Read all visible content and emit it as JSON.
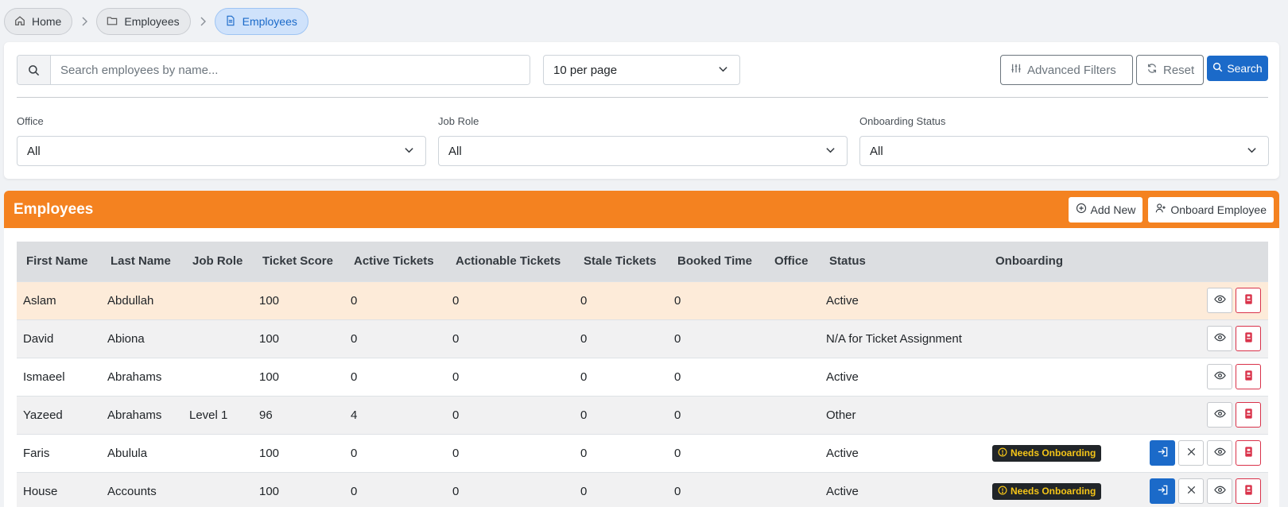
{
  "breadcrumb": [
    {
      "label": "Home",
      "icon": "home-icon"
    },
    {
      "label": "Employees",
      "icon": "folder-icon"
    },
    {
      "label": "Employees",
      "icon": "document-icon"
    }
  ],
  "filters": {
    "search_placeholder": "Search employees by name...",
    "per_page": "10 per page",
    "advanced_label": "Advanced Filters",
    "reset_label": "Reset",
    "search_label": "Search",
    "office_label": "Office",
    "office_value": "All",
    "jobrole_label": "Job Role",
    "jobrole_value": "All",
    "onboarding_label": "Onboarding Status",
    "onboarding_value": "All"
  },
  "employees": {
    "title": "Employees",
    "add_new": "Add New",
    "onboard": "Onboard Employee",
    "columns": [
      "First Name",
      "Last Name",
      "Job Role",
      "Ticket Score",
      "Active Tickets",
      "Actionable Tickets",
      "Stale Tickets",
      "Booked Time",
      "Office",
      "Status",
      "Onboarding"
    ],
    "rows": [
      [
        "Aslam",
        "Abdullah",
        "",
        "100",
        "0",
        "0",
        "0",
        "0",
        "",
        "Active",
        ""
      ],
      [
        "David",
        "Abiona",
        "",
        "100",
        "0",
        "0",
        "0",
        "0",
        "",
        "N/A for Ticket Assignment",
        ""
      ],
      [
        "Ismaeel",
        "Abrahams",
        "",
        "100",
        "0",
        "0",
        "0",
        "0",
        "",
        "Active",
        ""
      ],
      [
        "Yazeed",
        "Abrahams",
        "Level 1",
        "96",
        "4",
        "0",
        "0",
        "0",
        "",
        "Other",
        ""
      ],
      [
        "Faris",
        "Abulula",
        "",
        "100",
        "0",
        "0",
        "0",
        "0",
        "",
        "Active",
        "Needs Onboarding"
      ],
      [
        "House",
        "Accounts",
        "",
        "100",
        "0",
        "0",
        "0",
        "0",
        "",
        "Active",
        "Needs Onboarding"
      ]
    ]
  },
  "colors": {
    "accent": "#f48220",
    "primary": "#1b6ac9",
    "danger": "#d9324a",
    "highlight_row": "#fdebd9"
  }
}
